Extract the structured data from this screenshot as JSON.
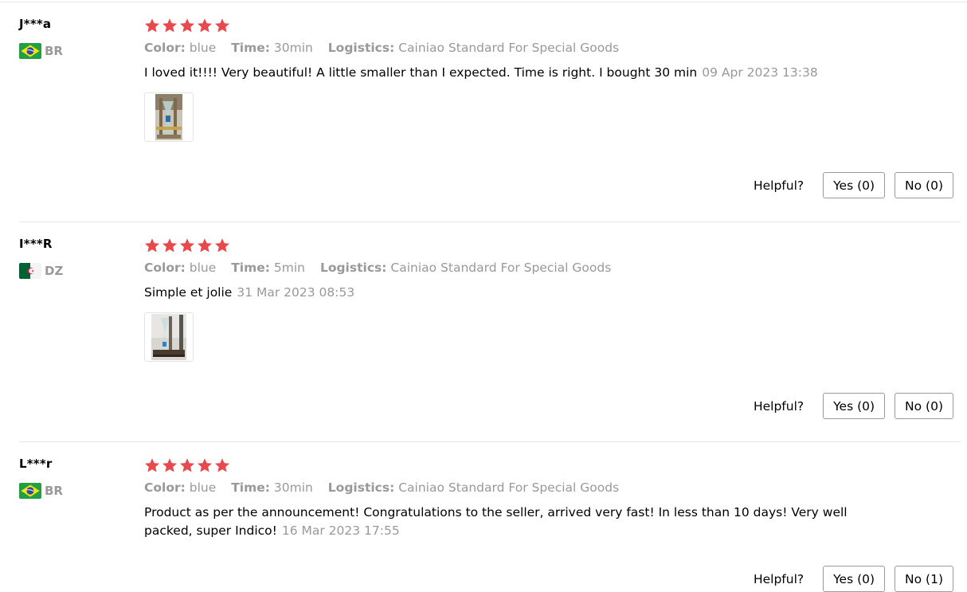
{
  "reviews": [
    {
      "user": "J***a",
      "country": "BR",
      "rating": 5,
      "color_label": "Color:",
      "color_value": "blue",
      "time_label": "Time:",
      "time_value": "30min",
      "logistics_label": "Logistics:",
      "logistics_value": "Cainiao Standard For Special Goods",
      "text": "I loved it!!!! Very beautiful! A little smaller than I expected. Time is right. I bought 30 min",
      "date": "09 Apr 2023 13:38",
      "helpful_label": "Helpful?",
      "yes_label": "Yes (0)",
      "no_label": "No (0)"
    },
    {
      "user": "I***R",
      "country": "DZ",
      "rating": 5,
      "color_label": "Color:",
      "color_value": "blue",
      "time_label": "Time:",
      "time_value": "5min",
      "logistics_label": "Logistics:",
      "logistics_value": "Cainiao Standard For Special Goods",
      "text": "Simple et jolie",
      "date": "31 Mar 2023 08:53",
      "helpful_label": "Helpful?",
      "yes_label": "Yes (0)",
      "no_label": "No (0)"
    },
    {
      "user": "L***r",
      "country": "BR",
      "rating": 5,
      "color_label": "Color:",
      "color_value": "blue",
      "time_label": "Time:",
      "time_value": "30min",
      "logistics_label": "Logistics:",
      "logistics_value": "Cainiao Standard For Special Goods",
      "text_line1": "Product as per the announcement! Congratulations to the seller, arrived very fast! In less than 10 days! Very well",
      "text_line2": "packed, super Indico!",
      "date": "16 Mar 2023 17:55",
      "helpful_label": "Helpful?",
      "yes_label": "Yes (0)",
      "no_label": "No (1)"
    }
  ],
  "colors": {
    "star": "#e8494f",
    "muted": "#999999",
    "brazil_green": "#229e45",
    "brazil_yellow": "#f8e509",
    "brazil_blue": "#2b49a3",
    "algeria_green": "#006233",
    "algeria_red": "#d21034"
  },
  "icons": {
    "star": "star-icon",
    "flag_br": "brazil-flag-icon",
    "flag_dz": "algeria-flag-icon"
  }
}
